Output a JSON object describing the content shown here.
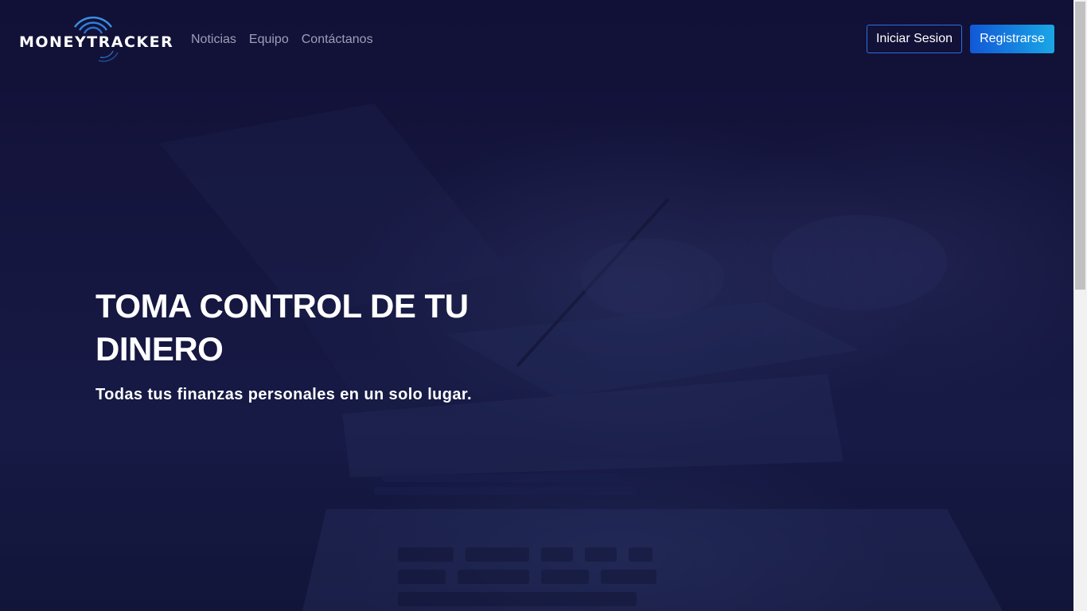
{
  "brand": {
    "logo_text": "MONEYTRACKER"
  },
  "nav": {
    "items": [
      {
        "label": "Noticias"
      },
      {
        "label": "Equipo"
      },
      {
        "label": "Contáctanos"
      }
    ]
  },
  "auth": {
    "login_label": "Iniciar Sesion",
    "register_label": "Registrarse"
  },
  "hero": {
    "title": "TOMA CONTROL DE TU DINERO",
    "subtitle": "Todas tus finanzas personales en un solo lugar."
  },
  "colors": {
    "background": "#12123a",
    "accent_start": "#1158d6",
    "accent_end": "#1aa6e6",
    "login_border": "#2f6fe0",
    "nav_text": "#9aa0b8"
  },
  "icons": {
    "logo_mark": "signal-arcs-icon"
  }
}
